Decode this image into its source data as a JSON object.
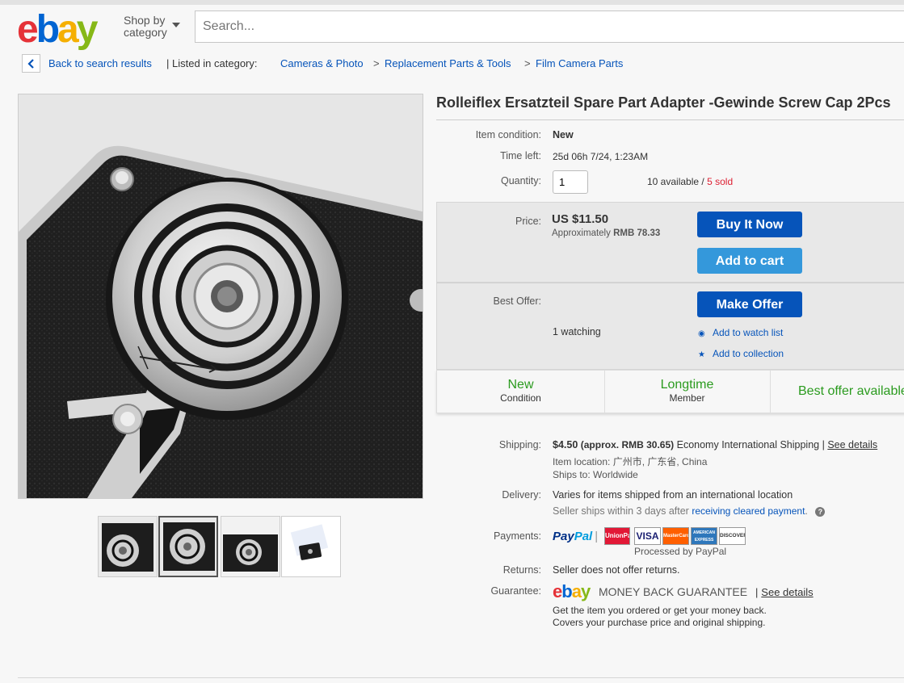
{
  "header": {
    "logo": {
      "e": "e",
      "b": "b",
      "a": "a",
      "y": "y"
    },
    "shop_by_line1": "Shop by",
    "shop_by_line2": "category",
    "search_placeholder": "Search..."
  },
  "breadcrumb": {
    "back_label": "Back to search results",
    "listed_in": "| Listed in category:",
    "items": [
      "Cameras & Photo",
      "Replacement Parts & Tools",
      "Film Camera Parts"
    ],
    "separator": ">"
  },
  "listing": {
    "title": "Rolleiflex Ersatzteil Spare Part Adapter -Gewinde Screw Cap 2Pcs",
    "condition_label": "Item condition:",
    "condition_value": "New",
    "time_left_label": "Time left:",
    "time_left_value": "25d 06h 7/24, 1:23AM",
    "quantity_label": "Quantity:",
    "quantity_value": "1",
    "available": "10 available",
    "slash": "/",
    "sold": "5 sold",
    "price_label": "Price:",
    "price_value": "US $11.50",
    "approx_prefix": "Approximately",
    "approx_value": "RMB 78.33",
    "buy_now": "Buy It Now",
    "add_to_cart": "Add to cart",
    "best_offer_label": "Best Offer:",
    "make_offer": "Make Offer",
    "watching": "1 watching",
    "add_watch": "Add to watch list",
    "add_collection": "Add to collection"
  },
  "badges": [
    {
      "title": "New",
      "sub": "Condition"
    },
    {
      "title": "Longtime",
      "sub": "Member"
    },
    {
      "title": "Best offer available",
      "sub": ""
    }
  ],
  "details": {
    "shipping_label": "Shipping:",
    "shipping_price": "$4.50",
    "shipping_approx": "(approx. RMB 30.65)",
    "shipping_method": "Economy International Shipping |",
    "see_details": "See details",
    "location_label": "Item location:",
    "location_value": "广州市, 广东省, China",
    "ships_to_label": "Ships to:",
    "ships_to_value": "Worldwide",
    "delivery_label": "Delivery:",
    "delivery_value": "Varies for items shipped from an international location",
    "seller_ships": "Seller ships within 3 days after",
    "receiving_cleared": "receiving cleared payment",
    "period": ".",
    "payments_label": "Payments:",
    "paypal_pay": "Pay",
    "paypal_pal": "Pal",
    "cards": [
      "UnionPay",
      "VISA",
      "MasterCard",
      "AMERICAN EXPRESS",
      "DISCOVER"
    ],
    "processed_by": "Processed by PayPal",
    "returns_label": "Returns:",
    "returns_value": "Seller does not offer returns.",
    "guarantee_label": "Guarantee:",
    "mbg_text": "MONEY BACK GUARANTEE",
    "mbg_sep": "|",
    "mbg_see": "See details",
    "mbg_line1": "Get the item you ordered or get your money back.",
    "mbg_line2": "Covers your purchase price and original shipping."
  },
  "colors": {
    "ebay_e": "#e53238",
    "ebay_b": "#0064d2",
    "ebay_a": "#f5af02",
    "ebay_y": "#86b817",
    "primary_button": "#0654ba",
    "secondary_button": "#3498db",
    "badge_green": "#2b9b1f",
    "sold_red": "#dd1e31"
  }
}
